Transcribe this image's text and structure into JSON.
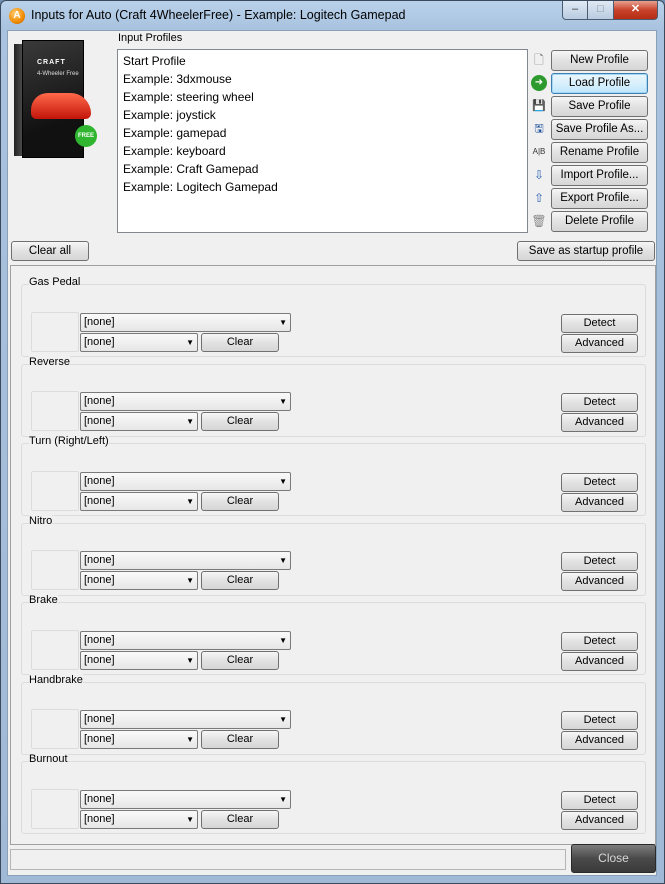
{
  "window": {
    "title": "Inputs for Auto (Craft 4WheelerFree) - Example: Logitech Gamepad",
    "app_icon": "A",
    "min_glyph": "–",
    "max_glyph": "□",
    "close_glyph": "✕"
  },
  "product_box": {
    "brand": "CRAFT",
    "subtitle": "4-Wheeler Free",
    "badge": "FREE"
  },
  "profiles": {
    "label": "Input Profiles",
    "items": [
      "Start Profile",
      "Example: 3dxmouse",
      "Example: steering wheel",
      "Example: joystick",
      "Example: gamepad",
      "Example: keyboard",
      "Example: Craft Gamepad",
      "Example: Logitech Gamepad"
    ]
  },
  "profile_buttons": {
    "new": "New Profile",
    "load": "Load Profile",
    "save": "Save Profile",
    "save_as": "Save Profile As...",
    "rename": "Rename Profile",
    "import": "Import Profile...",
    "export": "Export Profile...",
    "delete": "Delete Profile"
  },
  "icons": {
    "new": "🗋",
    "load": "➜",
    "save": "💾",
    "save_as": "🖫",
    "rename": "A|B",
    "import": "⇩",
    "export": "⇧",
    "delete": "🗑"
  },
  "toolbar": {
    "clear_all": "Clear all",
    "save_startup": "Save as startup profile"
  },
  "sections": [
    {
      "label": "Gas Pedal",
      "primary": "[none]",
      "secondary": "[none]",
      "clear": "Clear",
      "detect": "Detect",
      "advanced": "Advanced"
    },
    {
      "label": "Reverse",
      "primary": "[none]",
      "secondary": "[none]",
      "clear": "Clear",
      "detect": "Detect",
      "advanced": "Advanced"
    },
    {
      "label": "Turn (Right/Left)",
      "primary": "[none]",
      "secondary": "[none]",
      "clear": "Clear",
      "detect": "Detect",
      "advanced": "Advanced"
    },
    {
      "label": "Nitro",
      "primary": "[none]",
      "secondary": "[none]",
      "clear": "Clear",
      "detect": "Detect",
      "advanced": "Advanced"
    },
    {
      "label": "Brake",
      "primary": "[none]",
      "secondary": "[none]",
      "clear": "Clear",
      "detect": "Detect",
      "advanced": "Advanced"
    },
    {
      "label": "Handbrake",
      "primary": "[none]",
      "secondary": "[none]",
      "clear": "Clear",
      "detect": "Detect",
      "advanced": "Advanced"
    },
    {
      "label": "Burnout",
      "primary": "[none]",
      "secondary": "[none]",
      "clear": "Clear",
      "detect": "Detect",
      "advanced": "Advanced"
    }
  ],
  "footer": {
    "status": "",
    "close": "Close"
  },
  "colors": {
    "accent_focus": "#3c7fb1",
    "window_frame": "#a8c2df",
    "close_button": "#c8432a"
  }
}
